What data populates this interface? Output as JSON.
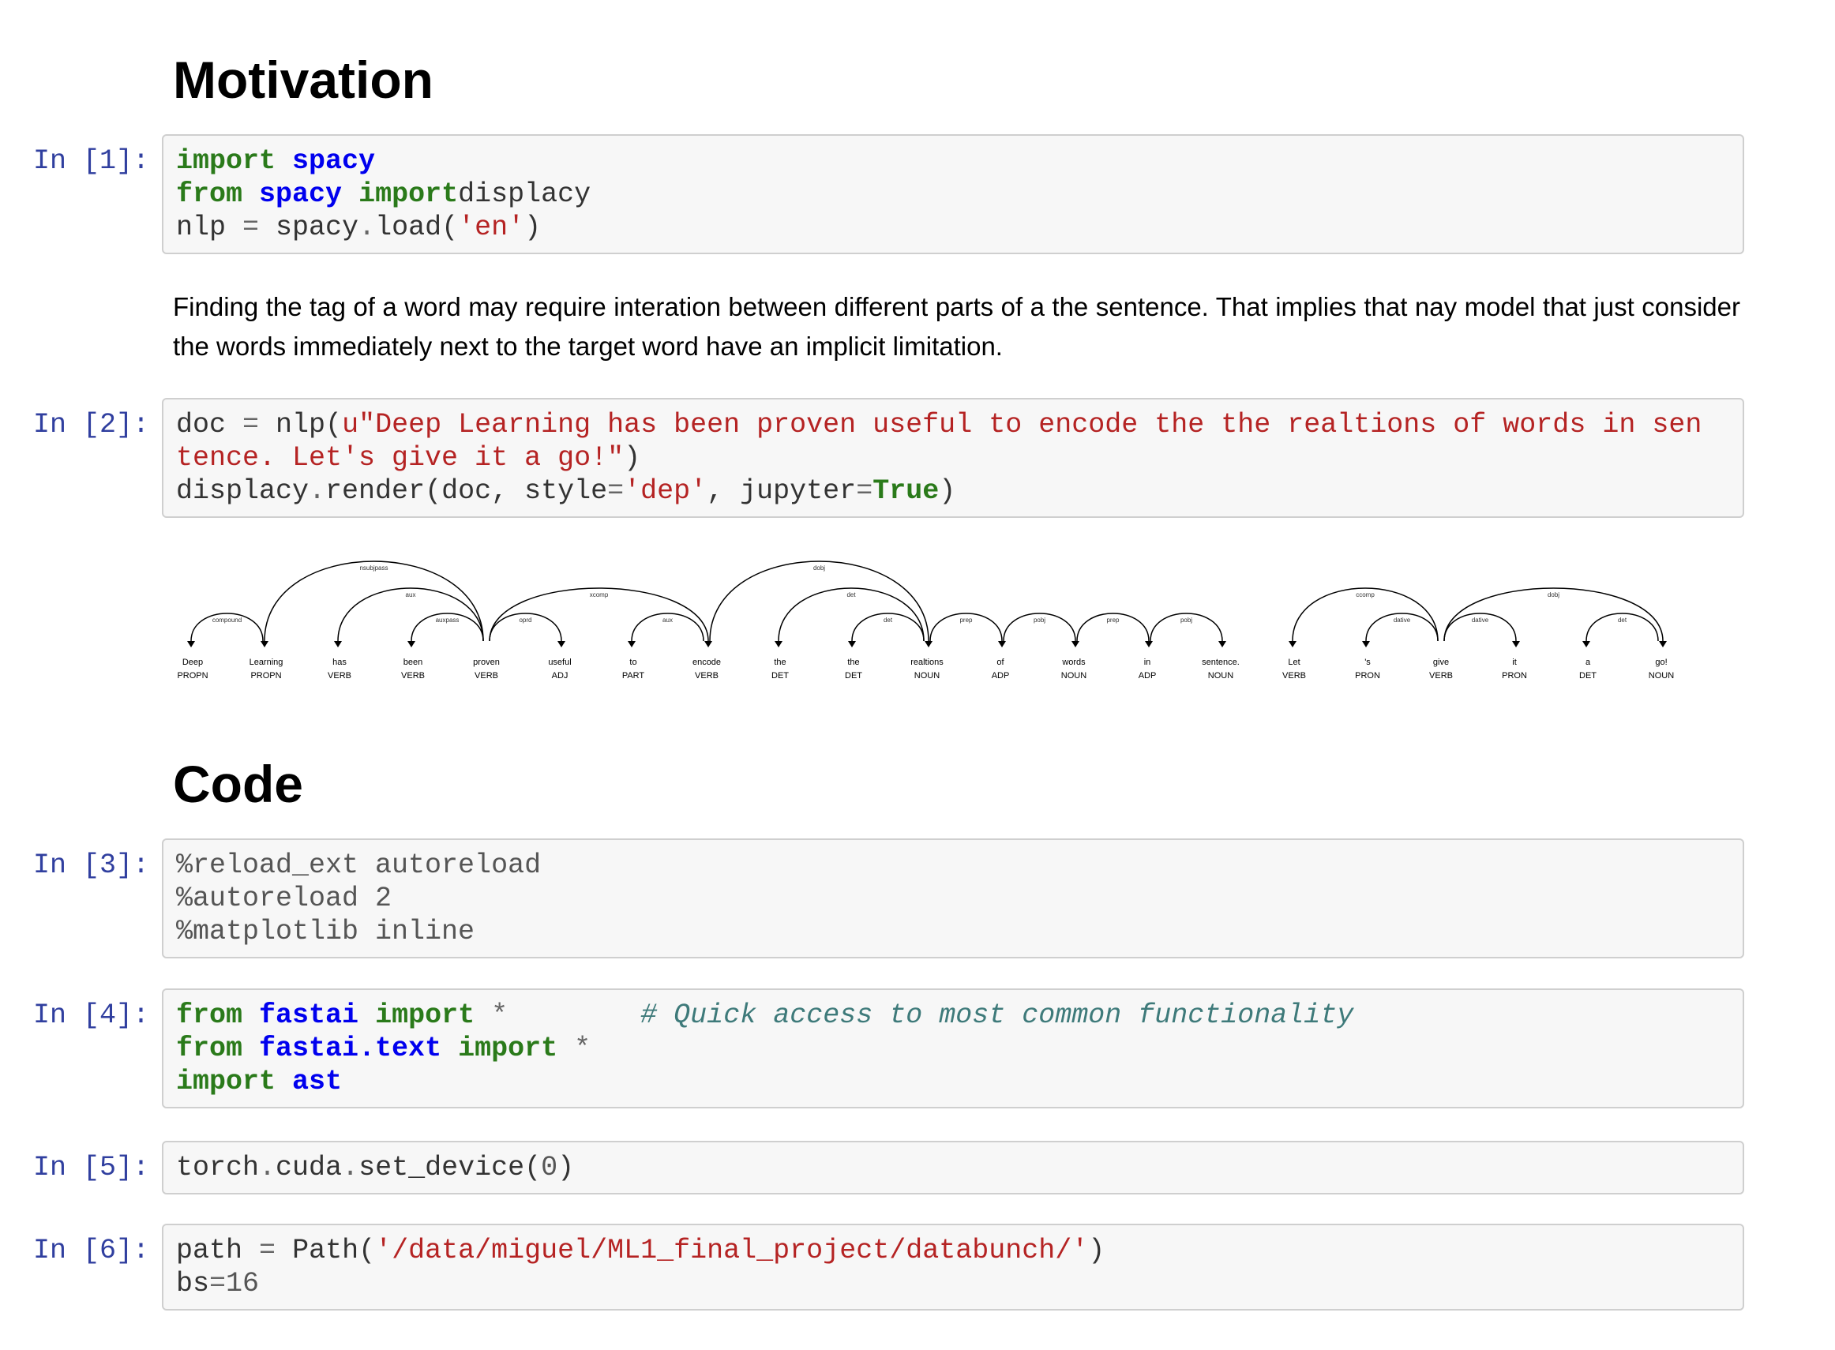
{
  "headings": {
    "motivation": "Motivation",
    "code": "Code"
  },
  "paragraph": "Finding the tag of a word may require interation between different parts of a the sentence. That implies that nay model that just consider the words immediately next to the target word have an implicit limitation.",
  "cells": [
    {
      "prompt": "In [1]:",
      "lines": [
        [
          [
            "kw",
            "import"
          ],
          [
            "",
            "' '"
          ],
          [
            "nm",
            "spacy"
          ]
        ],
        [
          [
            "kw",
            "from"
          ],
          [
            "",
            ""
          ],
          [
            "nm",
            "spacy"
          ],
          [
            "",
            ""
          ],
          [
            "kw",
            "import"
          ],
          [
            "",
            "displacy"
          ]
        ],
        [
          [
            "",
            "nlp "
          ],
          [
            "op",
            "="
          ],
          [
            "",
            ""
          ],
          [
            "",
            "spacy"
          ],
          [
            "op",
            "."
          ],
          [
            "",
            "load("
          ],
          [
            "st",
            "'en'"
          ],
          [
            "",
            ")"
          ]
        ]
      ]
    },
    {
      "prompt": "In [2]:",
      "lines": [
        [
          [
            "",
            "doc "
          ],
          [
            "op",
            "="
          ],
          [
            "",
            ""
          ],
          [
            "",
            "nlp("
          ],
          [
            "st",
            "u\"Deep Learning has been proven useful to encode the the realtions of words in sentence. Let's give it a go!\""
          ],
          [
            "",
            ")"
          ]
        ],
        [
          [
            "",
            "displacy"
          ],
          [
            "op",
            "."
          ],
          [
            "",
            "render(doc, style"
          ],
          [
            "op",
            "="
          ],
          [
            "st",
            "'dep'"
          ],
          [
            "",
            ", jupyter"
          ],
          [
            "op",
            "="
          ],
          [
            "kw",
            "True"
          ],
          [
            "",
            ")"
          ]
        ]
      ]
    },
    {
      "prompt": "In [3]:",
      "lines": [
        [
          [
            "mg",
            "%reload_ext autoreload"
          ]
        ],
        [
          [
            "mg",
            "%autoreload "
          ],
          [
            "num",
            "2"
          ]
        ],
        [
          [
            "mg",
            "%matplotlib inline"
          ]
        ]
      ]
    },
    {
      "prompt": "In [4]:",
      "lines": [
        [
          [
            "kw",
            "from"
          ],
          [
            "",
            ""
          ],
          [
            "nm",
            "fastai"
          ],
          [
            "",
            ""
          ],
          [
            "kw",
            "import"
          ],
          [
            "",
            ""
          ],
          [
            "op",
            "*"
          ],
          [
            "",
            "        "
          ],
          [
            "cm",
            "# Quick access to most common functionality"
          ]
        ],
        [
          [
            "kw",
            "from"
          ],
          [
            "",
            ""
          ],
          [
            "nm",
            "fastai.text"
          ],
          [
            "",
            ""
          ],
          [
            "kw",
            "import"
          ],
          [
            "",
            ""
          ],
          [
            "op",
            "*"
          ]
        ],
        [
          [
            "kw",
            "import"
          ],
          [
            "",
            ""
          ],
          [
            "nm",
            "ast"
          ]
        ]
      ]
    },
    {
      "prompt": "In [5]:",
      "lines": [
        [
          [
            "",
            "torch"
          ],
          [
            "op",
            "."
          ],
          [
            "",
            "cuda"
          ],
          [
            "op",
            "."
          ],
          [
            "",
            "set_device("
          ],
          [
            "num",
            "0"
          ],
          [
            "",
            ")"
          ]
        ]
      ]
    },
    {
      "prompt": "In [6]:",
      "lines": [
        [
          [
            "",
            "path "
          ],
          [
            "op",
            "="
          ],
          [
            "",
            ""
          ],
          [
            "",
            "Path("
          ],
          [
            "st",
            "'/data/miguel/ML1_final_project/databunch/'"
          ],
          [
            "",
            ")"
          ]
        ],
        [
          [
            "",
            "bs"
          ],
          [
            "op",
            "="
          ],
          [
            "num",
            "16"
          ]
        ]
      ]
    }
  ],
  "dependency_parse": {
    "tokens": [
      {
        "text": "Deep",
        "tag": "PROPN"
      },
      {
        "text": "Learning",
        "tag": "PROPN"
      },
      {
        "text": "has",
        "tag": "VERB"
      },
      {
        "text": "been",
        "tag": "VERB"
      },
      {
        "text": "proven",
        "tag": "VERB"
      },
      {
        "text": "useful",
        "tag": "ADJ"
      },
      {
        "text": "to",
        "tag": "PART"
      },
      {
        "text": "encode",
        "tag": "VERB"
      },
      {
        "text": "the",
        "tag": "DET"
      },
      {
        "text": "the",
        "tag": "DET"
      },
      {
        "text": "realtions",
        "tag": "NOUN"
      },
      {
        "text": "of",
        "tag": "ADP"
      },
      {
        "text": "words",
        "tag": "NOUN"
      },
      {
        "text": "in",
        "tag": "ADP"
      },
      {
        "text": "sentence.",
        "tag": "NOUN"
      },
      {
        "text": "Let",
        "tag": "VERB"
      },
      {
        "text": "'s",
        "tag": "PRON"
      },
      {
        "text": "give",
        "tag": "VERB"
      },
      {
        "text": "it",
        "tag": "PRON"
      },
      {
        "text": "a",
        "tag": "DET"
      },
      {
        "text": "go!",
        "tag": "NOUN"
      }
    ],
    "arcs": [
      {
        "start": 0,
        "end": 1,
        "label": "compound",
        "dir": "left"
      },
      {
        "start": 1,
        "end": 4,
        "label": "nsubjpass",
        "dir": "left"
      },
      {
        "start": 2,
        "end": 4,
        "label": "aux",
        "dir": "left"
      },
      {
        "start": 3,
        "end": 4,
        "label": "auxpass",
        "dir": "left"
      },
      {
        "start": 4,
        "end": 5,
        "label": "oprd",
        "dir": "right"
      },
      {
        "start": 4,
        "end": 7,
        "label": "xcomp",
        "dir": "right"
      },
      {
        "start": 6,
        "end": 7,
        "label": "aux",
        "dir": "left"
      },
      {
        "start": 7,
        "end": 10,
        "label": "dobj",
        "dir": "right"
      },
      {
        "start": 8,
        "end": 10,
        "label": "det",
        "dir": "left"
      },
      {
        "start": 9,
        "end": 10,
        "label": "det",
        "dir": "left"
      },
      {
        "start": 10,
        "end": 11,
        "label": "prep",
        "dir": "right"
      },
      {
        "start": 11,
        "end": 12,
        "label": "pobj",
        "dir": "right"
      },
      {
        "start": 12,
        "end": 13,
        "label": "prep",
        "dir": "right"
      },
      {
        "start": 13,
        "end": 14,
        "label": "pobj",
        "dir": "right"
      },
      {
        "start": 15,
        "end": 17,
        "label": "ccomp",
        "dir": "left"
      },
      {
        "start": 16,
        "end": 17,
        "label": "dative",
        "dir": "left"
      },
      {
        "start": 17,
        "end": 18,
        "label": "dative",
        "dir": "right"
      },
      {
        "start": 17,
        "end": 20,
        "label": "dobj",
        "dir": "right"
      },
      {
        "start": 19,
        "end": 20,
        "label": "det",
        "dir": "left"
      }
    ]
  }
}
